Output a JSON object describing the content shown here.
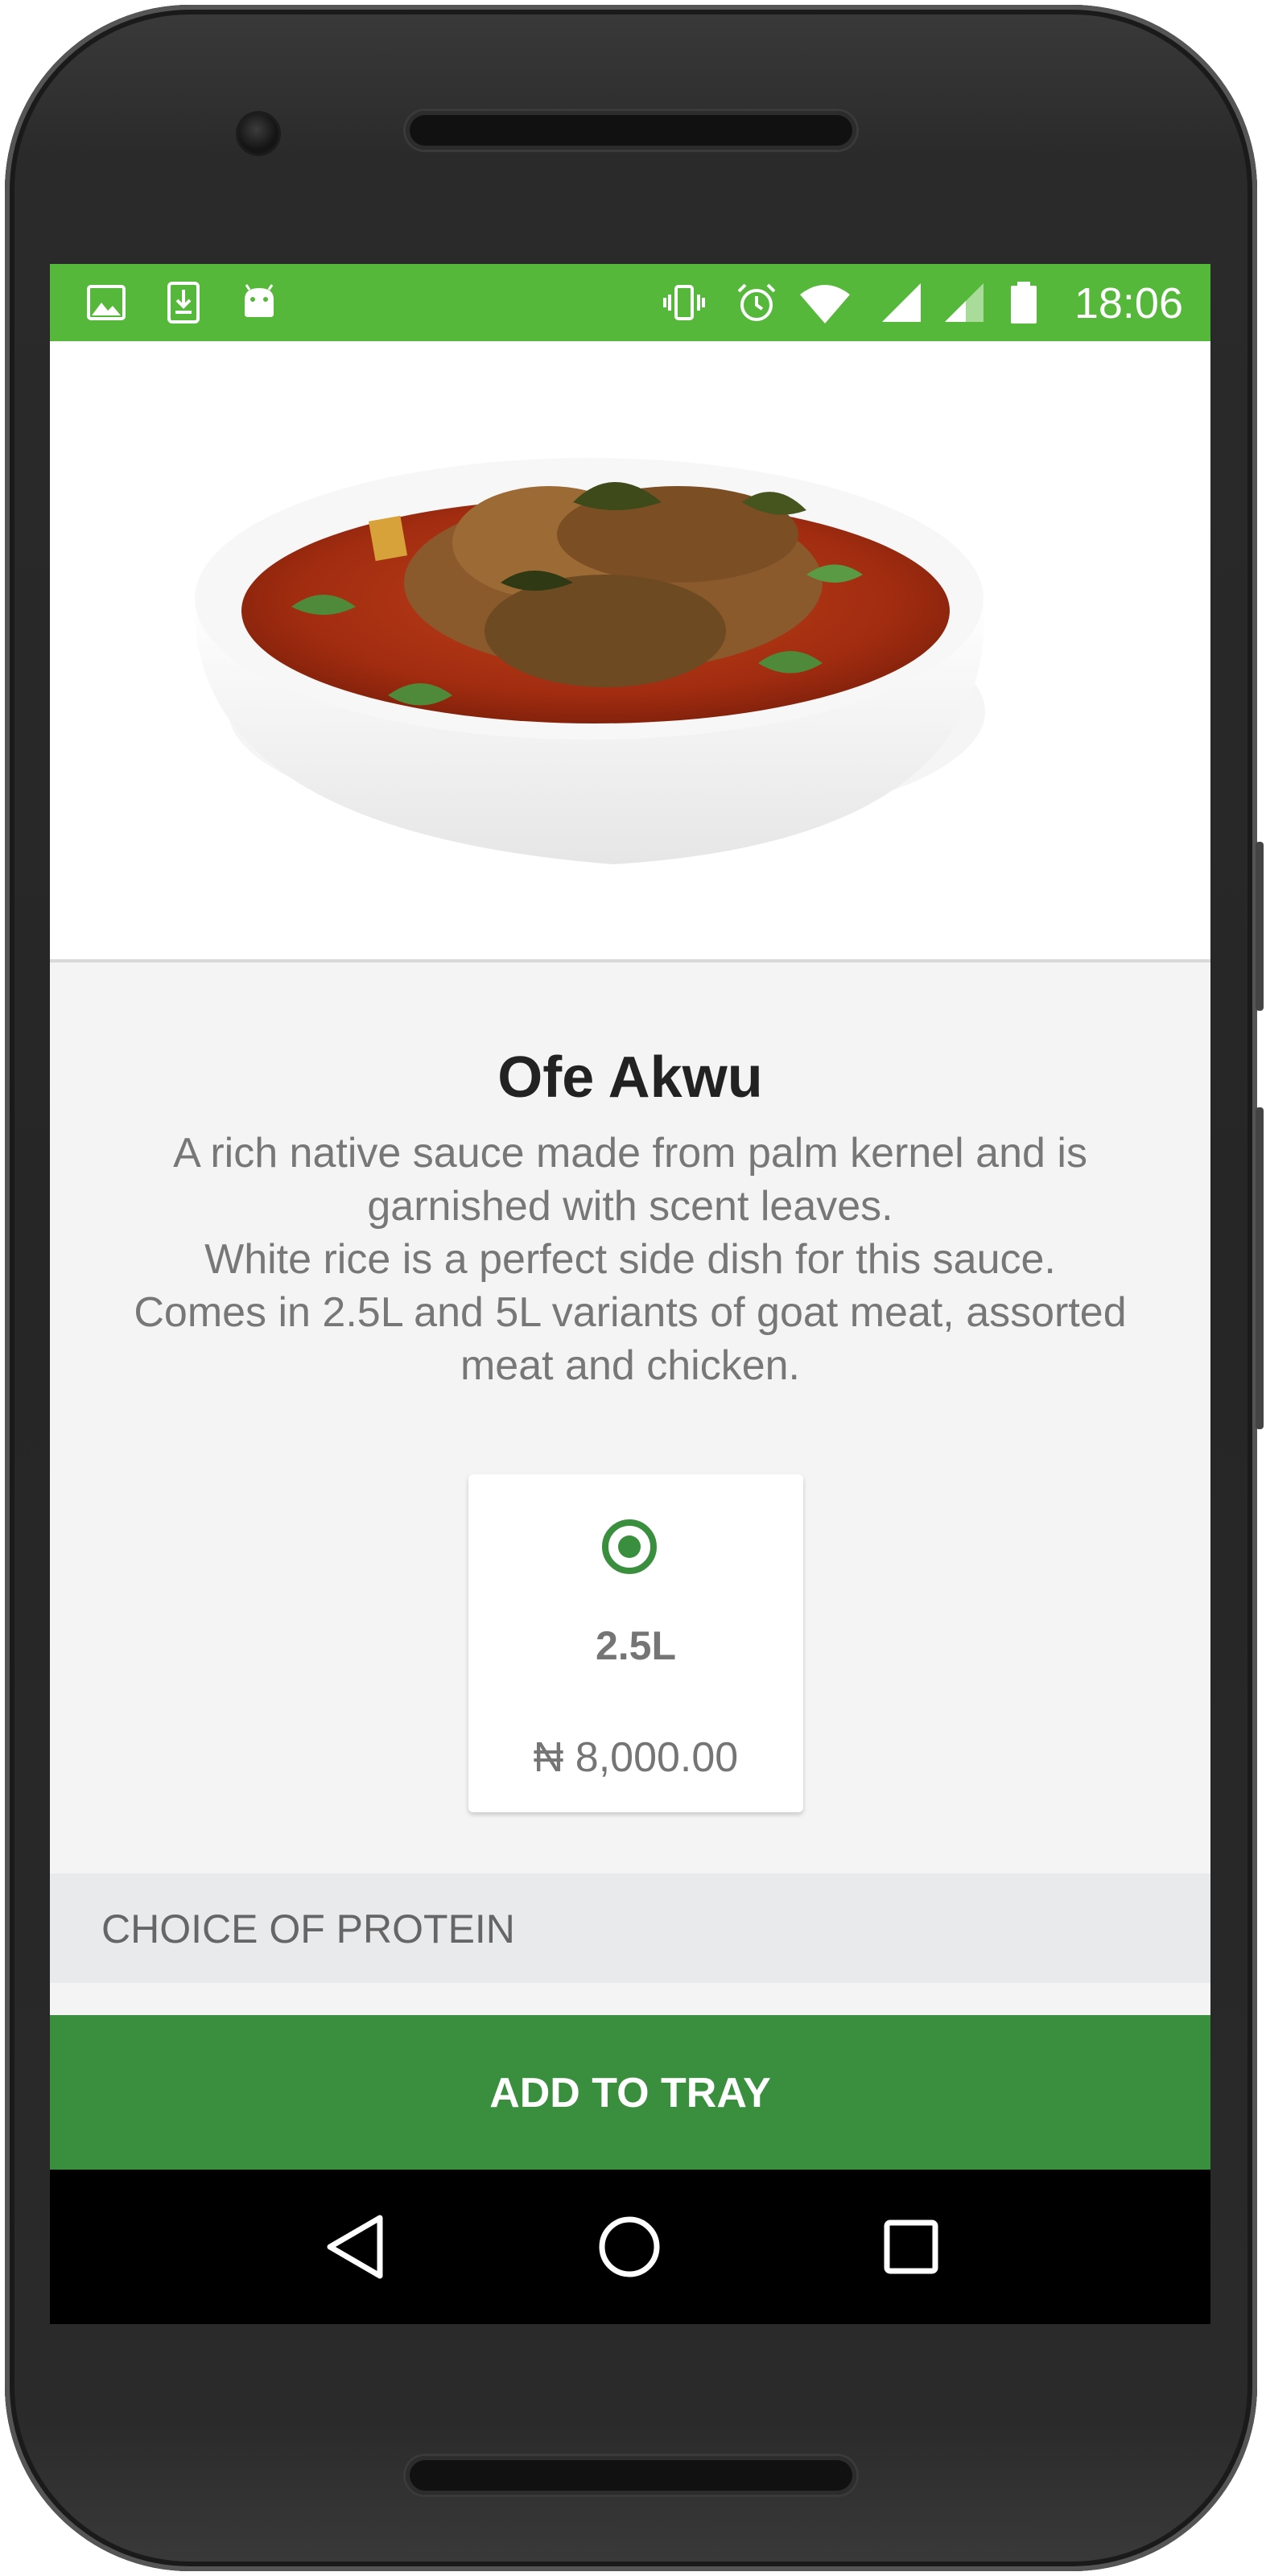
{
  "status_bar": {
    "left_icons": [
      "image-icon",
      "download-icon",
      "android-icon"
    ],
    "right_icons": [
      "vibrate-icon",
      "alarm-icon",
      "wifi-icon",
      "signal-icon",
      "signal-weak-icon",
      "battery-icon"
    ],
    "time": "18:06",
    "color": "#55b83a"
  },
  "product": {
    "image_icon": "soup-bowl-image",
    "title": "Ofe Akwu",
    "description": "A rich native sauce made from palm kernel and is garnished with scent leaves.\nWhite rice is a perfect side dish for this sauce.\nComes in 2.5L and 5L variants of goat meat, assorted meat and chicken."
  },
  "variants": [
    {
      "size": "2.5L",
      "price": "₦ 8,000.00",
      "selected": true
    }
  ],
  "section": {
    "protein_label": "CHOICE OF PROTEIN"
  },
  "actions": {
    "add_label": "ADD TO TRAY",
    "accent": "#3a8f3e"
  },
  "nav": {
    "icons": [
      "back-icon",
      "home-icon",
      "recents-icon"
    ]
  }
}
